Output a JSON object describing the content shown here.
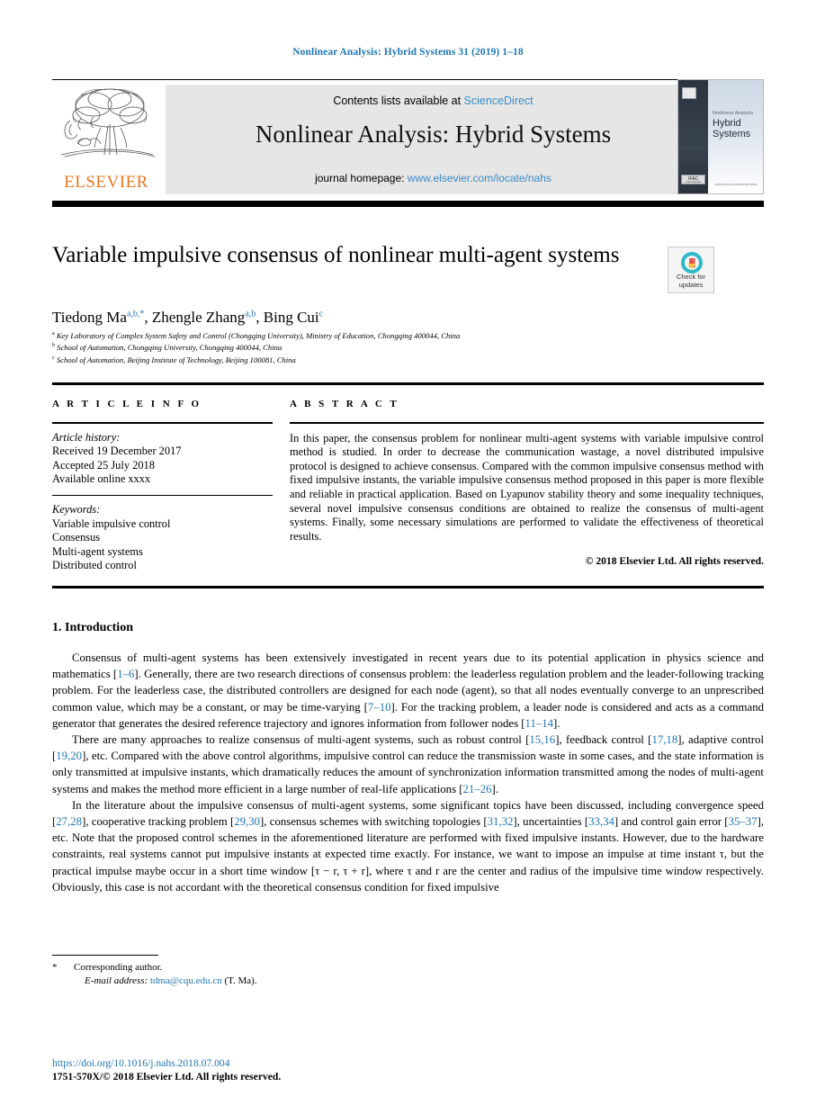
{
  "running_head": "Nonlinear Analysis: Hybrid Systems 31 (2019) 1–18",
  "masthead": {
    "publisher_logo_text": "ELSEVIER",
    "contents_prefix": "Contents lists available at ",
    "contents_link": "ScienceDirect",
    "journal_name": "Nonlinear Analysis: Hybrid Systems",
    "homepage_prefix": "journal homepage: ",
    "homepage_url": "www.elsevier.com/locate/nahs",
    "cover": {
      "superline": "Nonlinear Analysis",
      "title_line1": "Hybrid",
      "title_line2": "Systems",
      "badge_text": "IFAC",
      "badge_sub": "International Federation of Automatic Control",
      "footer_text": "www.elsevier.com/locate/nahs"
    }
  },
  "article": {
    "title": "Variable impulsive consensus of nonlinear multi-agent systems",
    "crossmark": {
      "line1": "Check for",
      "line2": "updates"
    },
    "authors": [
      {
        "name": "Tiedong Ma",
        "sup": "a,b,*"
      },
      {
        "name": "Zhengle Zhang",
        "sup": "a,b"
      },
      {
        "name": "Bing Cui",
        "sup": "c"
      }
    ],
    "affiliations": [
      {
        "marker": "a",
        "text": "Key Laboratory of Complex System Safety and Control (Chongqing University), Ministry of Education, Chongqing  400044, China"
      },
      {
        "marker": "b",
        "text": "School of Automation, Chongqing University, Chongqing  400044, China"
      },
      {
        "marker": "c",
        "text": "School of Automation, Beijing Institute of Technology, Beijing  100081, China"
      }
    ]
  },
  "article_info": {
    "heading": "A R T I C L E   I N F O",
    "history_label": "Article history:",
    "history": [
      "Received 19 December 2017",
      "Accepted 25 July 2018",
      "Available online xxxx"
    ],
    "keywords_label": "Keywords:",
    "keywords": [
      "Variable impulsive control",
      "Consensus",
      "Multi-agent systems",
      "Distributed control"
    ]
  },
  "abstract": {
    "heading": "A B S T R A C T",
    "text": "In this paper, the consensus problem for nonlinear multi-agent systems with variable impulsive control method is studied. In order to decrease the communication wastage, a novel distributed impulsive protocol is designed to achieve consensus. Compared with the common impulsive consensus method with fixed impulsive instants, the variable impulsive consensus method proposed in this paper is more flexible and reliable in practical application. Based on Lyapunov stability theory and some inequality techniques, several novel impulsive consensus conditions are obtained to realize the consensus of multi-agent systems. Finally, some necessary simulations are performed to validate the effectiveness of theoretical results.",
    "copyright": "© 2018 Elsevier Ltd. All rights reserved."
  },
  "body": {
    "section_number_title": "1.  Introduction",
    "paragraphs": [
      [
        {
          "t": "Consensus of multi-agent systems has been extensively investigated in recent years due to its potential application in physics science and mathematics [",
          "k": "plain"
        },
        {
          "t": "1–6",
          "k": "ref"
        },
        {
          "t": "]. Generally, there are two research directions of consensus problem: the leaderless regulation problem and the leader-following tracking problem. For the leaderless case, the distributed controllers are designed for each node (agent), so that all nodes eventually converge to an unprescribed common value, which may be a constant, or may be time-varying [",
          "k": "plain"
        },
        {
          "t": "7–10",
          "k": "ref"
        },
        {
          "t": "]. For the tracking problem, a leader node is considered and acts as a command generator that generates the desired reference trajectory and ignores information from follower nodes [",
          "k": "plain"
        },
        {
          "t": "11–14",
          "k": "ref"
        },
        {
          "t": "].",
          "k": "plain"
        }
      ],
      [
        {
          "t": "There are many approaches to realize consensus of multi-agent systems, such as robust control [",
          "k": "plain"
        },
        {
          "t": "15,16",
          "k": "ref"
        },
        {
          "t": "], feedback control [",
          "k": "plain"
        },
        {
          "t": "17,18",
          "k": "ref"
        },
        {
          "t": "], adaptive control [",
          "k": "plain"
        },
        {
          "t": "19,20",
          "k": "ref"
        },
        {
          "t": "], etc. Compared with the above control algorithms, impulsive control can reduce the transmission waste in some cases, and the state information is only transmitted at impulsive instants, which dramatically reduces the amount of synchronization information transmitted among the nodes of multi-agent systems and makes the method more efficient in a large number of real-life applications [",
          "k": "plain"
        },
        {
          "t": "21–26",
          "k": "ref"
        },
        {
          "t": "].",
          "k": "plain"
        }
      ],
      [
        {
          "t": "In the literature about the impulsive consensus of multi-agent systems, some significant topics have been discussed, including convergence speed [",
          "k": "plain"
        },
        {
          "t": "27,28",
          "k": "ref"
        },
        {
          "t": "], cooperative tracking problem [",
          "k": "plain"
        },
        {
          "t": "29,30",
          "k": "ref"
        },
        {
          "t": "], consensus schemes with switching topologies [",
          "k": "plain"
        },
        {
          "t": "31,32",
          "k": "ref"
        },
        {
          "t": "], uncertainties [",
          "k": "plain"
        },
        {
          "t": "33,34",
          "k": "ref"
        },
        {
          "t": "] and control gain error [",
          "k": "plain"
        },
        {
          "t": "35–37",
          "k": "ref"
        },
        {
          "t": "], etc. Note that the proposed control schemes in the aforementioned literature are performed with fixed impulsive instants. However, due to the hardware constraints, real systems cannot put impulsive instants at expected time exactly. For instance, we want to impose an impulse at time instant τ, but the practical impulse maybe occur in a short time window [τ − r, τ + r], where τ and r are the center and radius of the impulsive time window respectively. Obviously, this case is not accordant with the theoretical consensus condition for fixed impulsive",
          "k": "plain"
        }
      ]
    ]
  },
  "footer": {
    "corresponding_marker": "*",
    "corresponding_text": "Corresponding author.",
    "email_label": "E-mail address:",
    "email": "tdma@cqu.edu.cn",
    "email_suffix": "(T. Ma).",
    "doi": "https://doi.org/10.1016/j.nahs.2018.07.004",
    "issn_line": "1751-570X/© 2018 Elsevier Ltd. All rights reserved."
  },
  "colors": {
    "link": "#1f76b4",
    "elsevier_orange": "#e87722",
    "masthead_bg": "#e6e6e6"
  }
}
